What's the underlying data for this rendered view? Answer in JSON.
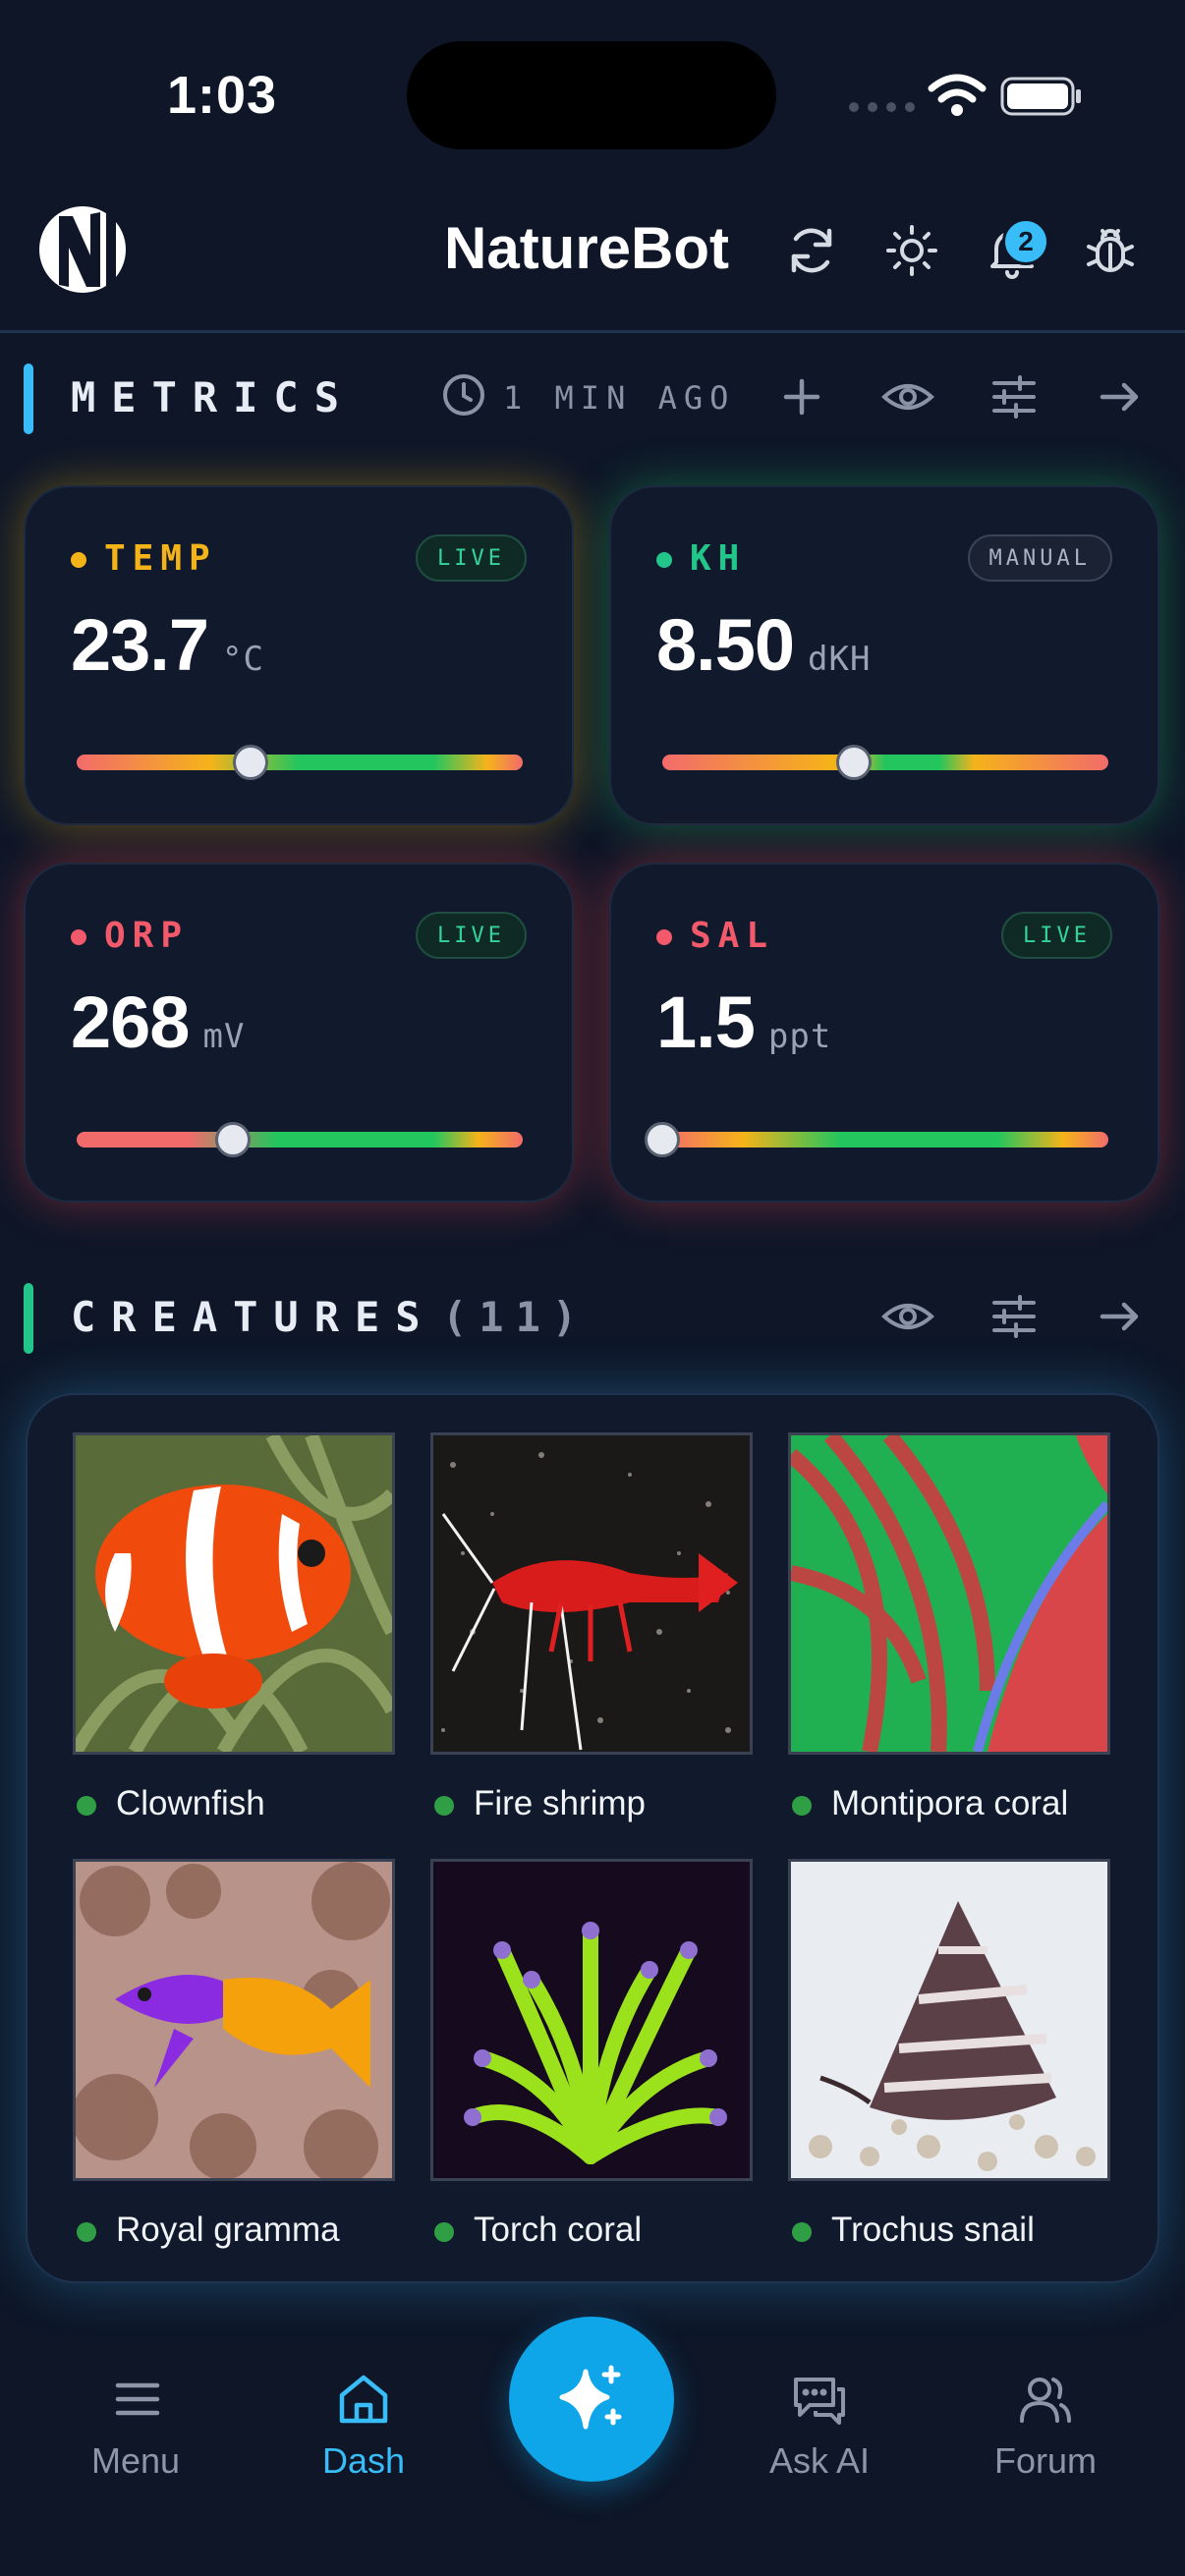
{
  "status_bar": {
    "time": "1:03"
  },
  "header": {
    "brand": "NatureBot",
    "notification_count": "2"
  },
  "metrics": {
    "title": "METRICS",
    "updated": "1 MIN AGO",
    "cards": [
      {
        "name": "TEMP",
        "value": "23.7",
        "unit": "°C",
        "badge": "LIVE",
        "color": "#f5b31a",
        "slider_fraction": 0.39
      },
      {
        "name": "KH",
        "value": "8.50",
        "unit": "dKH",
        "badge": "MANUAL",
        "color": "#22c58a",
        "slider_fraction": 0.43
      },
      {
        "name": "ORP",
        "value": "268",
        "unit": "mV",
        "badge": "LIVE",
        "color": "#f2596b",
        "slider_fraction": 0.35
      },
      {
        "name": "SAL",
        "value": "1.5",
        "unit": "ppt",
        "badge": "LIVE",
        "color": "#f2596b",
        "slider_fraction": 0.0
      }
    ]
  },
  "creatures": {
    "title": "CREATURES",
    "count": "(11)",
    "items": [
      {
        "name": "Clownfish",
        "image": "clownfish-photo"
      },
      {
        "name": "Fire shrimp",
        "image": "fire-shrimp-photo"
      },
      {
        "name": "Montipora coral",
        "image": "montipora-coral-photo"
      },
      {
        "name": "Royal gramma",
        "image": "royal-gramma-photo"
      },
      {
        "name": "Torch coral",
        "image": "torch-coral-photo"
      },
      {
        "name": "Trochus snail",
        "image": "trochus-snail-photo"
      }
    ]
  },
  "nav": {
    "menu": "Menu",
    "dash": "Dash",
    "ask_ai": "Ask AI",
    "forum": "Forum",
    "active_color": "#38bdf8",
    "accent": "#0ea5e9"
  }
}
